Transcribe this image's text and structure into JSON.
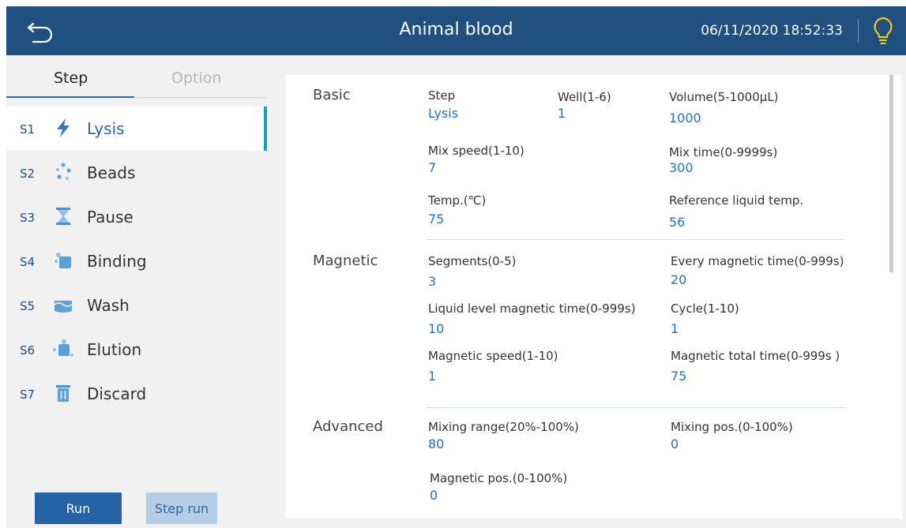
{
  "header": {
    "title": "Animal blood",
    "datetime": "06/11/2020 18:52:33"
  },
  "tabs": {
    "step": "Step",
    "option": "Option"
  },
  "steps": [
    {
      "num": "S1",
      "label": "Lysis",
      "icon": "lightning-icon"
    },
    {
      "num": "S2",
      "label": "Beads",
      "icon": "beads-icon"
    },
    {
      "num": "S3",
      "label": "Pause",
      "icon": "hourglass-icon"
    },
    {
      "num": "S4",
      "label": "Binding",
      "icon": "binding-icon"
    },
    {
      "num": "S5",
      "label": "Wash",
      "icon": "wash-icon"
    },
    {
      "num": "S6",
      "label": "Elution",
      "icon": "elution-icon"
    },
    {
      "num": "S7",
      "label": "Discard",
      "icon": "trash-icon"
    }
  ],
  "buttons": {
    "run": "Run",
    "step_run": "Step run"
  },
  "basic": {
    "label": "Basic",
    "step_label": "Step",
    "step_value": "Lysis",
    "well_label": "Well(1-6)",
    "well_value": "1",
    "volume_label": "Volume(5-1000µL)",
    "volume_value": "1000",
    "mix_speed_label": "Mix speed(1-10)",
    "mix_speed_value": "7",
    "mix_time_label": "Mix time(0-9999s)",
    "mix_time_value": "300",
    "temp_label": "Temp.(℃)",
    "temp_value": "75",
    "ref_temp_label": "Reference liquid temp.",
    "ref_temp_value": "56"
  },
  "magnetic": {
    "label": "Magnetic",
    "segments_label": "Segments(0-5)",
    "segments_value": "3",
    "every_time_label": "Every magnetic time(0-999s)",
    "every_time_value": "20",
    "liquid_time_label": "Liquid level magnetic time(0-999s)",
    "liquid_time_value": "10",
    "cycle_label": "Cycle(1-10)",
    "cycle_value": "1",
    "speed_label": "Magnetic speed(1-10)",
    "speed_value": "1",
    "total_time_label": "Magnetic total time(0-999s )",
    "total_time_value": "75"
  },
  "advanced": {
    "label": "Advanced",
    "mixing_range_label": "Mixing range(20%-100%)",
    "mixing_range_value": "80",
    "mixing_pos_label": "Mixing  pos.(0-100%)",
    "mixing_pos_value": "0",
    "magnetic_pos_label": "Magnetic  pos.(0-100%)",
    "magnetic_pos_value": "0"
  },
  "colors": {
    "header": "#20507f",
    "accent": "#2562a6",
    "value": "#1a73c8",
    "active_bar": "#14a0c8"
  }
}
